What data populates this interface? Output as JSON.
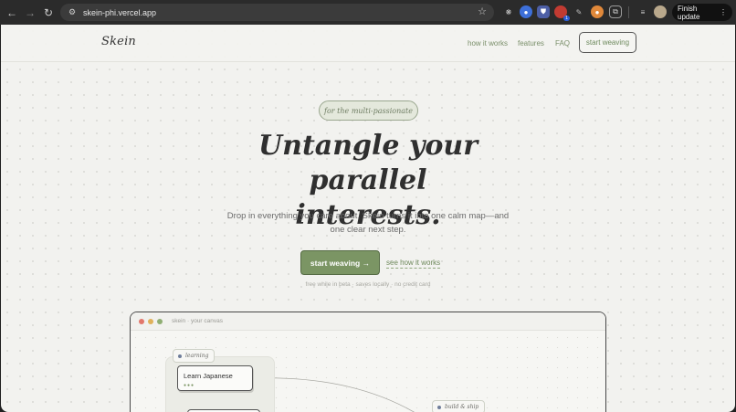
{
  "browser": {
    "url": "skein-phi.vercel.app",
    "finish_update_label": "Finish update",
    "extension_badge": "1"
  },
  "header": {
    "logo": "Skein",
    "nav": [
      "how it works",
      "features",
      "FAQ"
    ],
    "cta": "start weaving"
  },
  "hero": {
    "tag": "for the multi-passionate",
    "title_line1": "Untangle your parallel",
    "title_line2": "interests.",
    "subtitle": "Drop in everything you care about. Skein turns it into one calm map—and one clear next step.",
    "primary_cta": "start weaving →",
    "secondary_cta": "see how it works",
    "fineprint": "free while in beta · saves locally · no credit card"
  },
  "canvas": {
    "title": "skein · your canvas",
    "chip_learning": "learning",
    "card_title": "Learn Japanese",
    "card_dots": "●●●",
    "chip_build": "build & ship"
  },
  "colors": {
    "accent_green": "#7b9564",
    "window_red": "#e2776b",
    "window_yellow": "#e0b15a",
    "window_green": "#8fae73"
  }
}
